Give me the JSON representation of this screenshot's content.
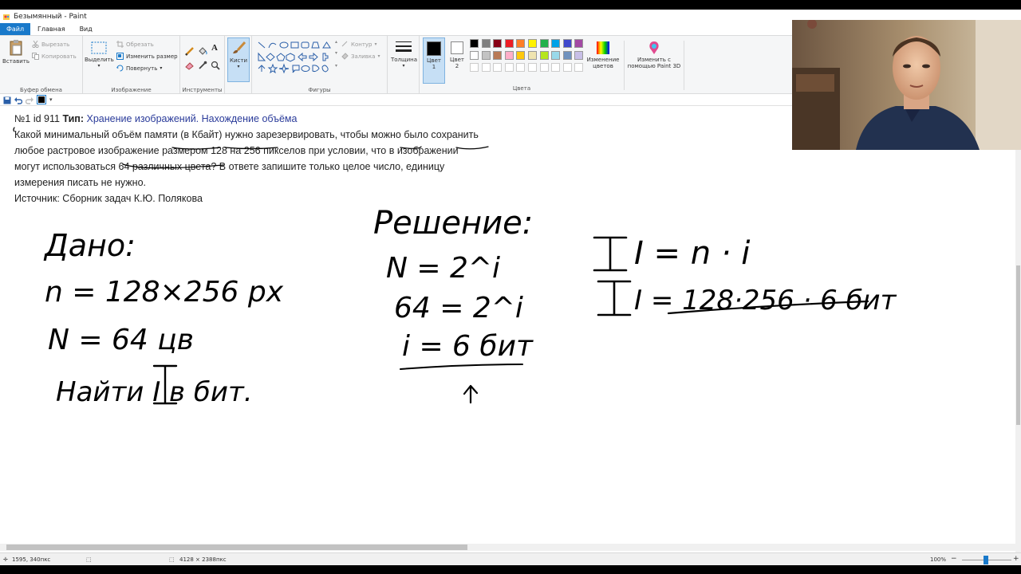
{
  "window": {
    "title": "Безымянный - Paint"
  },
  "tabs": {
    "file": "Файл",
    "home": "Главная",
    "view": "Вид"
  },
  "ribbon": {
    "clipboard": {
      "paste": "Вставить",
      "cut": "Вырезать",
      "copy": "Копировать",
      "label": "Буфер обмена"
    },
    "image": {
      "select": "Выделить",
      "crop": "Обрезать",
      "resize": "Изменить размер",
      "rotate": "Повернуть",
      "label": "Изображение"
    },
    "tools": {
      "label": "Инструменты"
    },
    "brushes": {
      "label": "Кисти"
    },
    "shapes": {
      "outline": "Контур",
      "fill": "Заливка",
      "label": "Фигуры"
    },
    "size": {
      "label": "Толщина"
    },
    "color1": {
      "label_line1": "Цвет",
      "label_line2": "1"
    },
    "color2": {
      "label_line1": "Цвет",
      "label_line2": "2"
    },
    "colors": {
      "label": "Цвета",
      "edit_line1": "Изменение",
      "edit_line2": "цветов",
      "paint3d_line1": "Изменить с",
      "paint3d_line2": "помощью Paint 3D"
    },
    "palette_row1": [
      "#000000",
      "#7f7f7f",
      "#880015",
      "#ed1c24",
      "#ff7f27",
      "#fff200",
      "#22b14c",
      "#00a2e8",
      "#3f48cc",
      "#a349a4"
    ],
    "palette_row2": [
      "#ffffff",
      "#c3c3c3",
      "#b97a57",
      "#ffaec9",
      "#ffc90e",
      "#efe4b0",
      "#b5e61d",
      "#99d9ea",
      "#7092be",
      "#c8bfe7"
    ]
  },
  "task": {
    "heading": "№1 id 911",
    "type_label": "Тип:",
    "type_value": "Хранение изображений. Нахождение объёма",
    "line1": "Какой минимальный объём памяти (в Кбайт) нужно зарезервировать, чтобы можно было сохранить",
    "line2": "любое растровое изображение размером 128 на 256 пикселов при условии, что в изображении",
    "line3": "могут использоваться 64 различных цвета? В ответе запишите только целое число, единицу",
    "line4": "измерения писать не нужно.",
    "source": "Источник: Сборник задач К.Ю. Полякова"
  },
  "handwriting": {
    "given_title": "Дано:",
    "given_n": "n = 128×256 px",
    "given_N": "N = 64 цв",
    "given_find": "Найти I в бит.",
    "solution_title": "Решение:",
    "sol_line1": "N = 2^i",
    "sol_line2": "64 = 2^i",
    "sol_line3": "i = 6 бит",
    "formula1": "I = n · i",
    "formula2": "I = 128·256 · 6 бит"
  },
  "status": {
    "cursor": "1595, 340пкс",
    "size": "4128 × 2388пкс",
    "zoom": "100%"
  }
}
